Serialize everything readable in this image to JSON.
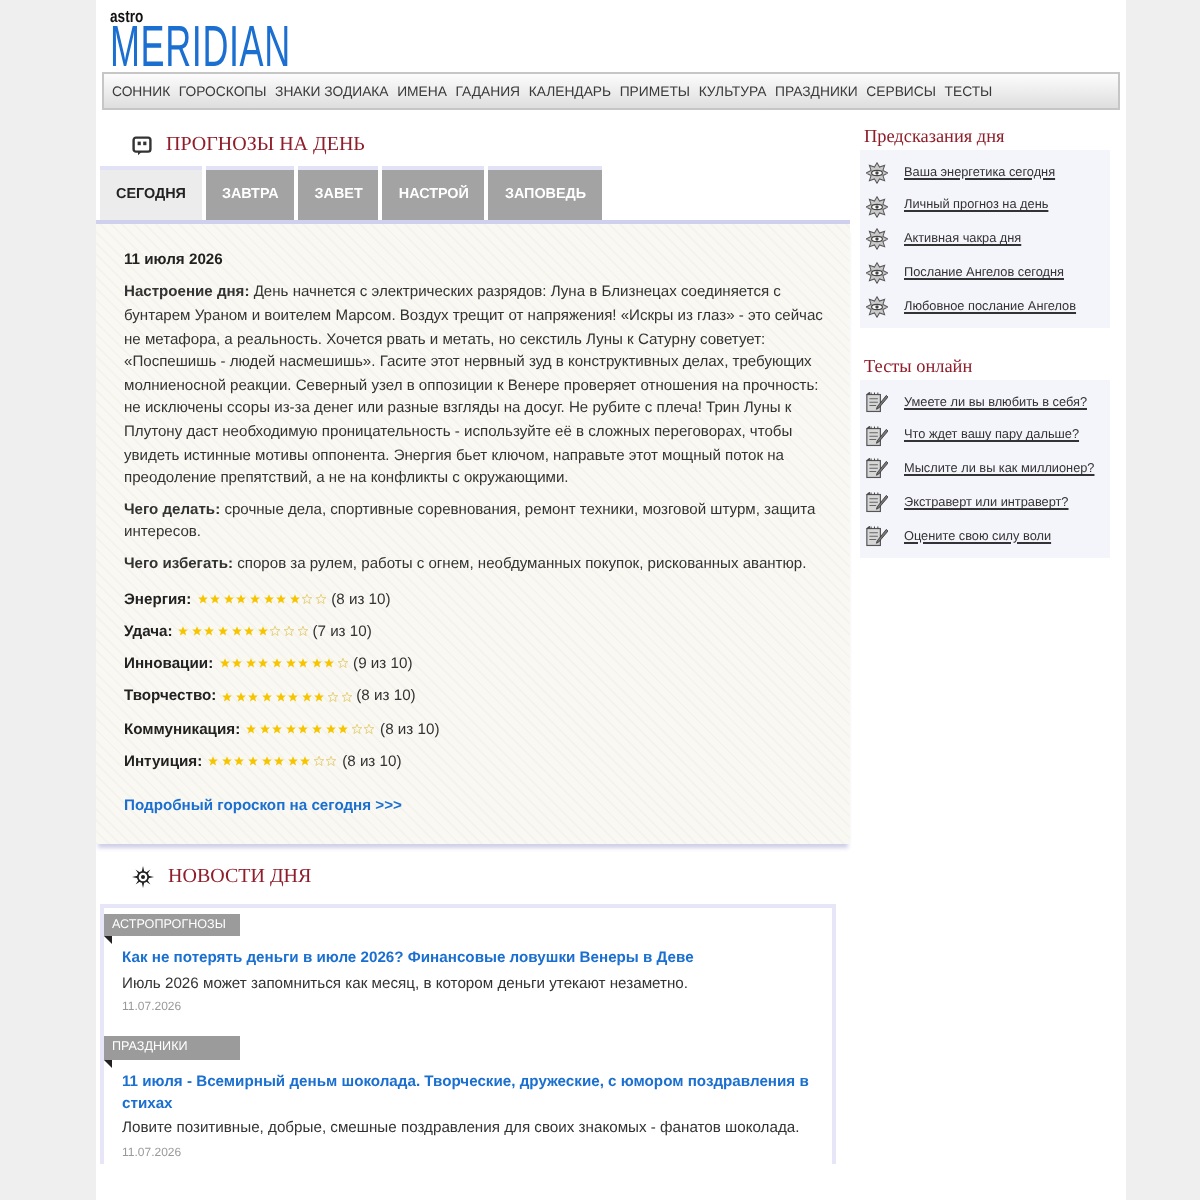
{
  "header": {
    "logo_prefix": "astro",
    "logo": "MERIDIAN"
  },
  "nav": [
    "СОННИК",
    "ГОРОСКОПЫ",
    "ЗНАКИ ЗОДИАКА",
    "ИМЕНА",
    "ГАДАНИЯ",
    "КАЛЕНДАРЬ",
    "ПРИМЕТЫ",
    "КУЛЬТУРА",
    "ПРАЗДНИКИ",
    "СЕРВИСЫ",
    "ТЕСТЫ"
  ],
  "forecast": {
    "title": "ПРОГНОЗЫ НА ДЕНЬ",
    "tabs": [
      {
        "label": "СЕГОДНЯ",
        "selected": true
      },
      {
        "label": "ЗАВТРА",
        "selected": false
      },
      {
        "label": "ЗАВЕТ",
        "selected": false
      },
      {
        "label": "НАСТРОЙ",
        "selected": false
      },
      {
        "label": "ЗАПОВЕДЬ",
        "selected": false
      }
    ],
    "date": "11 июля 2026",
    "sections": [
      "**Настроение дня:** День начнется с электрических разрядов: Луна в Близнецах соединяется с бунтарем Ураном и воителем Марсом. Воздух трещит от напряжения! «Искры из глаз» - это сейчас не метафора, а реальность. Хочется рвать и метать, но секстиль Луны к Сатурну советует: «Поспешишь - людей насмешишь». Гасите этот нервный зуд в конструктивных делах, требующих молниеносной реакции. Северный узел в оппозиции к Венере проверяет отношения на прочность: не исключены ссоры из-за денег или разные взгляды на досуг. Не рубите с плеча! Трин Луны к Плутону даст необходимую проницательность - используйте её в сложных переговорах, чтобы увидеть истинные мотивы оппонента. Энергия бьет ключом, направьте этот мощный поток на преодоление препятствий, а не на конфликты с окружающими.",
      "**Чего делать:** срочные дела, спортивные соревнования, ремонт техники, мозговой штурм, защита интересов.",
      "**Чего избегать:** споров за рулем, работы с огнем, необдуманных покупок, рискованных авантюр."
    ],
    "ratings": [
      {
        "label": "Энергия:",
        "stars": 8,
        "reading": "(8 из 10)"
      },
      {
        "label": "Удача:",
        "stars": 7,
        "reading": "(7 из 10)"
      },
      {
        "label": "Инновации:",
        "stars": 9,
        "reading": "(9 из 10)"
      },
      {
        "label": "Творчество:",
        "stars": 8,
        "reading": "(8 из 10)"
      },
      {
        "label": "Коммуникация:",
        "stars": 8,
        "reading": "(8 из 10)"
      },
      {
        "label": "Интуиция:",
        "stars": 8,
        "reading": "(8 из 10)"
      }
    ],
    "more_link": "Подробный гороскоп на сегодня >>>"
  },
  "news": {
    "title": "НОВОСТИ ДНЯ",
    "items": [
      {
        "category": "АСТРОПРОГНОЗЫ",
        "title": "Как не потерять деньги в июле 2026? Финансовые ловушки Венеры в Деве",
        "summary": "Июль 2026 может запомниться как месяц, в котором деньги утекают незаметно.",
        "date": "11.07.2026"
      },
      {
        "category": "ПРАЗДНИКИ",
        "title": "11 июля - Всемирный деньм шоколада. Творческие, дружеские, с юмором поздравления в стихах",
        "summary": "Ловите позитивные, добрые, смешные поздравления для своих знакомых - фанатов шоколада.",
        "date": "11.07.2026"
      }
    ]
  },
  "sidebar": [
    {
      "title": "Предсказания дня",
      "kind": "chakra",
      "items": [
        "Ваша энергетика сегодня",
        "Личный прогноз на день",
        "Активная чакра дня",
        "Послание Ангелов сегодня",
        "Любовное послание Ангелов"
      ]
    },
    {
      "title": "Тесты онлайн",
      "kind": "test",
      "items": [
        "Умеете ли вы влюбить в себя?",
        "Что ждет вашу пару дальше?",
        "Мыслите ли вы как миллионер?",
        "Экстраверт или интраверт?",
        "Оцените свою силу воли"
      ]
    }
  ]
}
